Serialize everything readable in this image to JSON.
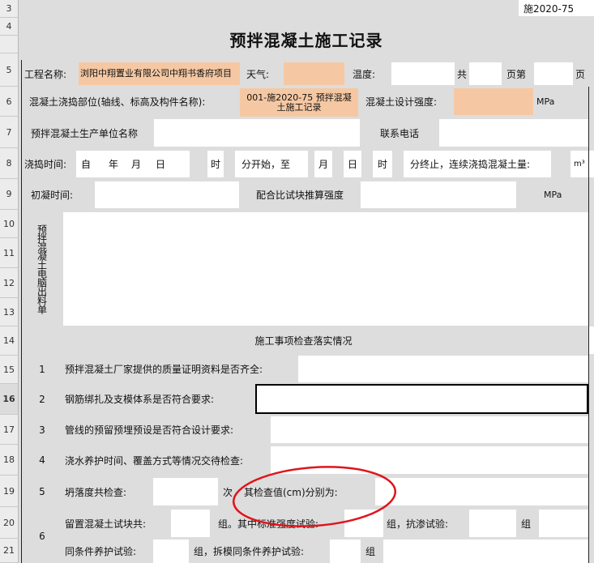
{
  "sheet": {
    "corner_code": "施2020-75",
    "title": "预拌混凝土施工记录",
    "row_numbers": [
      "3",
      "4",
      "5",
      "6",
      "7",
      "8",
      "9",
      "10",
      "11",
      "12",
      "13",
      "14",
      "15",
      "16",
      "17",
      "18",
      "19",
      "20",
      "21"
    ]
  },
  "row5": {
    "project_label": "工程名称:",
    "project_value": "浏阳中翔置业有限公司中翔书香府项目",
    "weather_label": "天气:",
    "temp_label": "温度:",
    "total_label": "共",
    "page_label": "页第",
    "page_end": "页"
  },
  "row6": {
    "pour_location_label": "混凝土浇捣部位(轴线、标高及构件名称):",
    "pour_location_value": "001-施2020-75 预拌混凝土施工记录",
    "design_strength_label": "混凝土设计强度:",
    "unit_mpa": "MPa"
  },
  "row7": {
    "producer_label": "预拌混凝土生产单位名称",
    "phone_label": "联系电话"
  },
  "row8": {
    "pour_time_label": "浇捣时间:",
    "from": "自",
    "year": "年",
    "month": "月",
    "day": "日",
    "hour": "时",
    "start_label": "分开始，至",
    "month2": "月",
    "day2": "日",
    "hour2": "时",
    "end_label": "分终止，连续浇捣混凝土量:",
    "unit_m3": "m³"
  },
  "row9": {
    "initial_set_label": "初凝时间:",
    "mix_strength_label": "配合比试块推算强度",
    "unit_mpa": "MPa"
  },
  "row10": {
    "ticket_label": "预拌混凝土电脑出料单"
  },
  "row14": {
    "section_title": "施工事项检查落实情况"
  },
  "checks": [
    {
      "no": "1",
      "text": "预拌混凝土厂家提供的质量证明资料是否齐全:"
    },
    {
      "no": "2",
      "text": "钢筋绑扎及支模体系是否符合要求:"
    },
    {
      "no": "3",
      "text": "管线的预留预埋预设是否符合设计要求:"
    },
    {
      "no": "4",
      "text": "浇水养护时间、覆盖方式等情况交待检查:"
    }
  ],
  "row19": {
    "no": "5",
    "slump_label": "坍落度共检查:",
    "times": "次",
    "values_label": "其检查值(cm)分别为:"
  },
  "row20": {
    "no": "6",
    "specimen_label": "留置混凝土试块共:",
    "groups_std": "组。其中标准强度试验:",
    "groups_imp": "组，抗渗试验:",
    "group": "组"
  },
  "row21": {
    "same_cond_label": "同条件养护试验:",
    "demold_label": "组，拆模同条件养护试验:",
    "group": "组"
  },
  "colors": {
    "gray": "#dddddd",
    "orange": "#f5c8a3",
    "annotation": "#e0141b"
  }
}
